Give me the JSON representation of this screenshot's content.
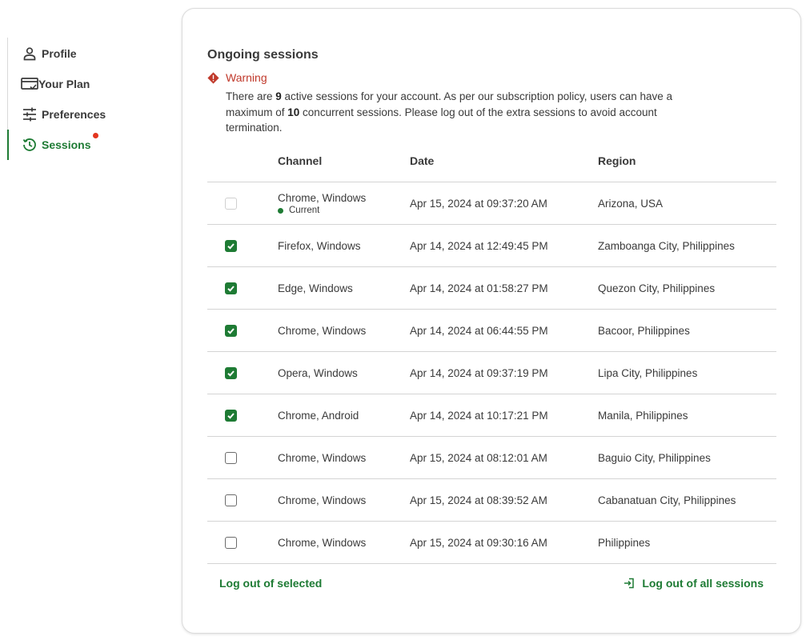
{
  "sidebar": {
    "items": [
      {
        "label": "Profile",
        "icon": "user-icon"
      },
      {
        "label": "Your Plan",
        "icon": "card-icon"
      },
      {
        "label": "Preferences",
        "icon": "sliders-icon"
      },
      {
        "label": "Sessions",
        "icon": "history-icon"
      }
    ]
  },
  "main": {
    "title": "Ongoing sessions",
    "warning": {
      "label": "Warning",
      "text_1": "There are ",
      "active_count": "9",
      "text_2": " active sessions for your account. As per our subscription policy, users can have a maximum of ",
      "max_count": "10",
      "text_3": " concurrent sessions. Please log out of the extra sessions to avoid account termination."
    },
    "table": {
      "headers": {
        "channel": "Channel",
        "date": "Date",
        "region": "Region"
      },
      "rows": [
        {
          "channel": "Chrome, Windows",
          "current": "Current",
          "date": "Apr 15, 2024 at 09:37:20 AM",
          "region": "Arizona, USA"
        },
        {
          "channel": "Firefox, Windows",
          "date": "Apr 14, 2024 at 12:49:45 PM",
          "region": "Zamboanga City, Philippines"
        },
        {
          "channel": "Edge, Windows",
          "date": "Apr 14, 2024 at 01:58:27 PM",
          "region": "Quezon City, Philippines"
        },
        {
          "channel": "Chrome, Windows",
          "date": "Apr 14, 2024 at 06:44:55 PM",
          "region": "Bacoor, Philippines"
        },
        {
          "channel": "Opera, Windows",
          "date": "Apr 14, 2024 at 09:37:19 PM",
          "region": "Lipa City, Philippines"
        },
        {
          "channel": "Chrome, Android",
          "date": "Apr 14, 2024 at 10:17:21 PM",
          "region": "Manila, Philippines"
        },
        {
          "channel": "Chrome, Windows",
          "date": "Apr 15, 2024 at 08:12:01 AM",
          "region": "Baguio City, Philippines"
        },
        {
          "channel": "Chrome, Windows",
          "date": "Apr 15, 2024 at 08:39:52 AM",
          "region": "Cabanatuan City, Philippines"
        },
        {
          "channel": "Chrome, Windows",
          "date": "Apr 15, 2024 at 09:30:16 AM",
          "region": "Philippines"
        }
      ],
      "checked": [
        false,
        true,
        true,
        true,
        true,
        true,
        false,
        false,
        false
      ]
    },
    "footer": {
      "logout_selected": "Log out of selected",
      "logout_all": "Log out of all sessions"
    }
  },
  "colors": {
    "accent": "#1e7b34",
    "warning": "#c0392b",
    "badge": "#e3351f"
  }
}
